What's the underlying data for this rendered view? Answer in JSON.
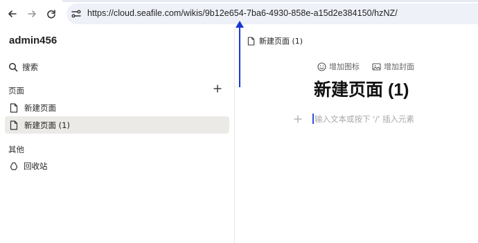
{
  "browser": {
    "url": "https://cloud.seafile.com/wikis/9b12e654-7ba6-4930-858e-a15d2e384150/hzNZ/",
    "icons": [
      "back-arrow-icon",
      "forward-arrow-icon",
      "reload-icon",
      "site-settings-icon"
    ]
  },
  "sidebar": {
    "brand": "admin456",
    "search_label": "搜索",
    "pages_heading": "页面",
    "pages": [
      {
        "label": "新建页面",
        "active": false
      },
      {
        "label": "新建页面 (1)",
        "active": true
      }
    ],
    "other_heading": "其他",
    "recycle_label": "回收站"
  },
  "main": {
    "breadcrumb": "新建页面 (1)",
    "add_icon_label": "增加图标",
    "add_cover_label": "增加封面",
    "title": "新建页面 (1)",
    "editor_placeholder": "输入文本或按下 '/' 插入元素"
  },
  "colors": {
    "active_item_bg": "#ebeae6",
    "url_bar_bg": "#eef1f8",
    "annotation_arrow": "#1a35d6",
    "caret": "#2c4fe0"
  }
}
